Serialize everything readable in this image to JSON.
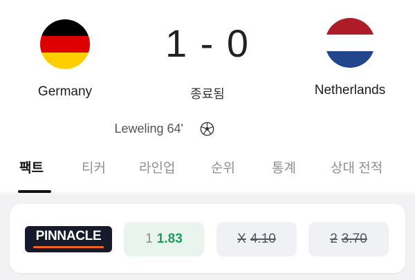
{
  "match": {
    "home": {
      "name": "Germany",
      "flag": [
        "#000000",
        "#dd0000",
        "#ffce00"
      ]
    },
    "away": {
      "name": "Netherlands",
      "flag": [
        "#ae1c28",
        "#ffffff",
        "#21468b"
      ]
    },
    "score": "1 - 0",
    "status": "종료됨"
  },
  "events": [
    {
      "player": "Leweling 64'",
      "icon": "soccer-ball-icon"
    }
  ],
  "tabs": [
    "팩트",
    "티커",
    "라인업",
    "순위",
    "통계",
    "상대 전적"
  ],
  "active_tab": "팩트",
  "odds": {
    "bookmaker": "PINNACLE",
    "brand_color": "#f26522",
    "home": {
      "label": "1",
      "value": "1.83"
    },
    "draw": {
      "label": "X",
      "value": "4.10"
    },
    "away": {
      "label": "2",
      "value": "3.70"
    }
  }
}
